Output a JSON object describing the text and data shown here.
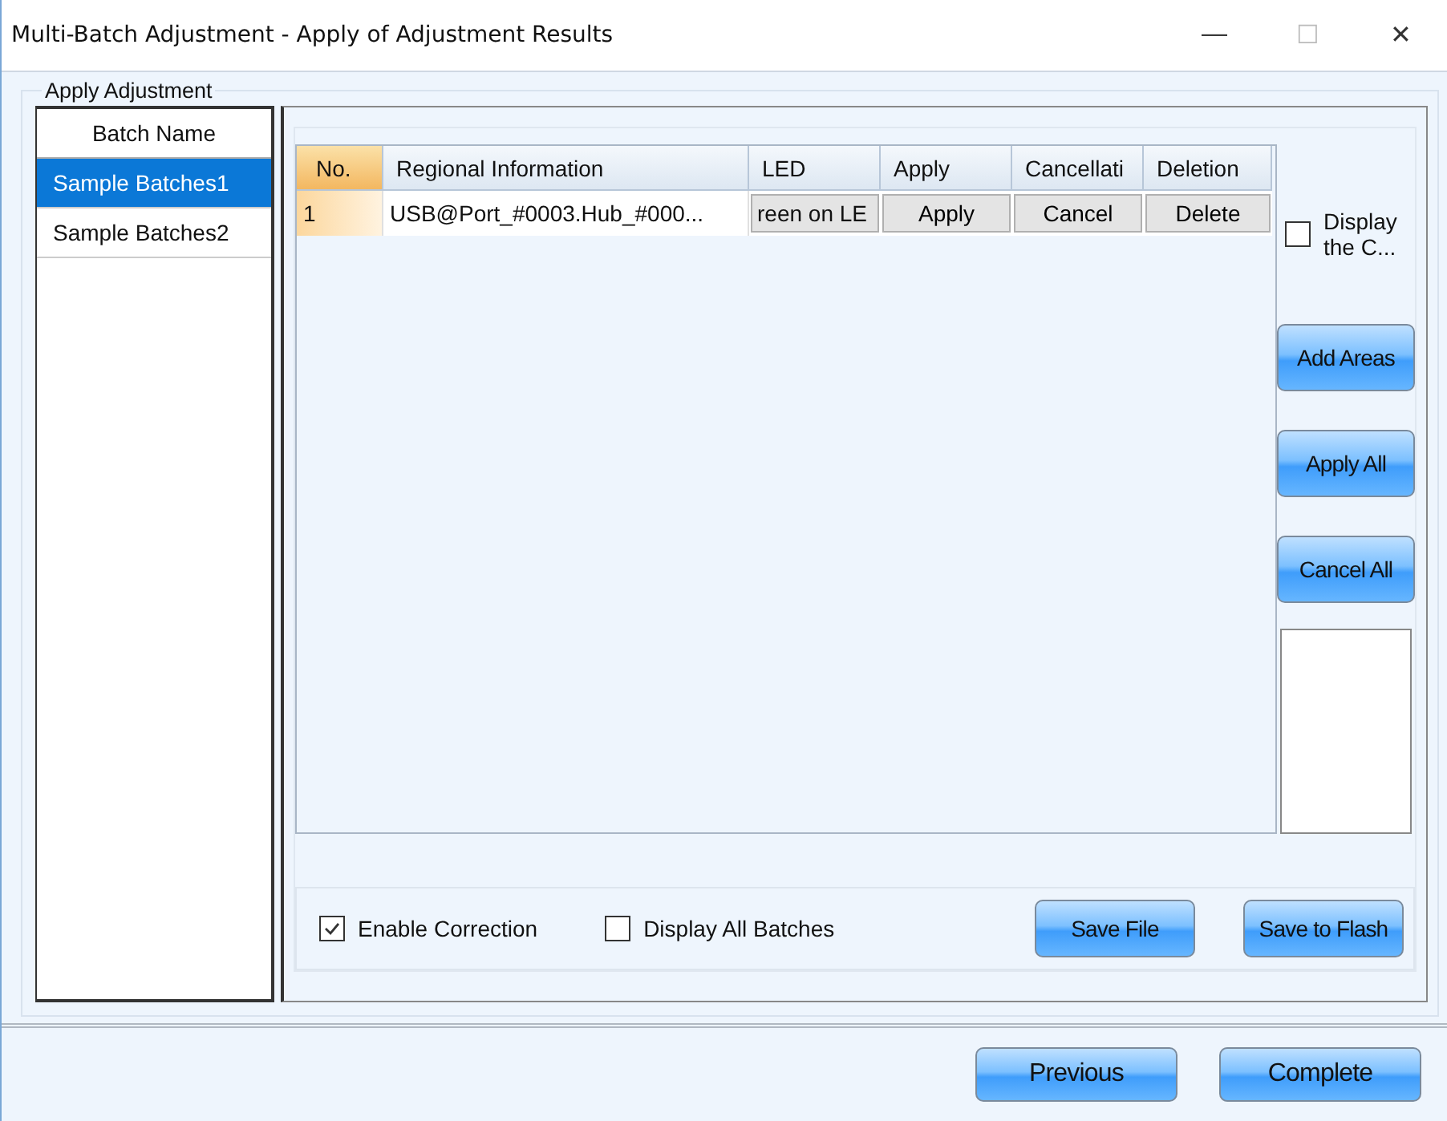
{
  "window": {
    "title": "Multi-Batch Adjustment - Apply of Adjustment Results",
    "controls": [
      "—",
      "☐",
      "✕"
    ]
  },
  "group_title": "Apply Adjustment",
  "batch_list": {
    "header": "Batch Name",
    "items": [
      {
        "label": "Sample Batches1",
        "selected": true
      },
      {
        "label": "Sample Batches2",
        "selected": false
      }
    ]
  },
  "table": {
    "columns": [
      "No.",
      "Regional Information",
      "LED",
      "Apply",
      "Cancellati",
      "Deletion"
    ],
    "rows": [
      {
        "no": "1",
        "region": "USB@Port_#0003.Hub_#000...",
        "led": "reen on LE",
        "apply": "Apply",
        "cancel": "Cancel",
        "delete": "Delete"
      }
    ]
  },
  "side": {
    "display_checkbox": {
      "label": "Display the C...",
      "checked": false
    },
    "buttons": [
      "Add Areas",
      "Apply All",
      "Cancel All"
    ]
  },
  "options": [
    {
      "label": "Enable Correction",
      "checked": true
    },
    {
      "label": "Display All Batches",
      "checked": false
    }
  ],
  "save_buttons": [
    "Save File",
    "Save to Flash"
  ],
  "footer_buttons": [
    "Previous",
    "Complete"
  ]
}
